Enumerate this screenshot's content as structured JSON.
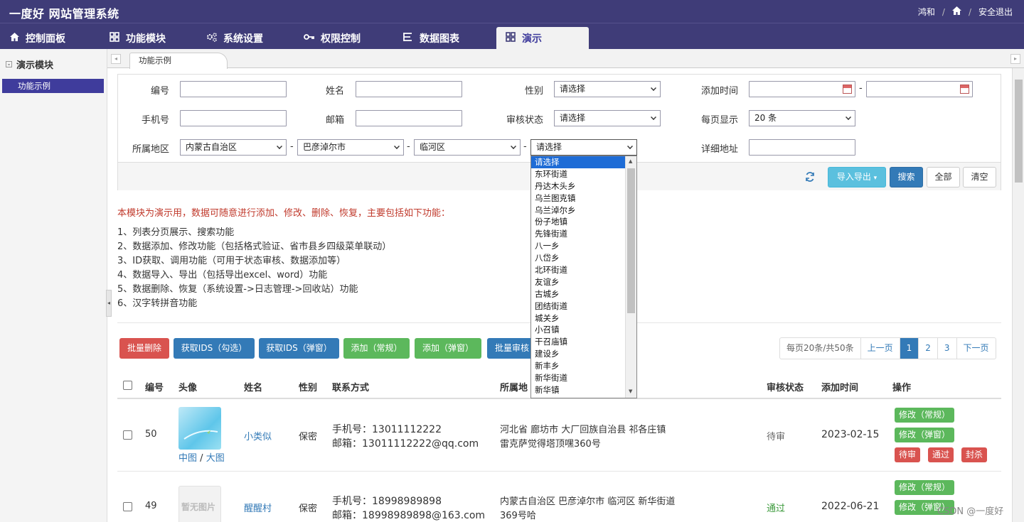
{
  "header": {
    "app_title": "一度好 网站管理系统",
    "user": "鸿和",
    "separator": "/",
    "home_icon": "home-icon",
    "logout": "安全退出"
  },
  "nav": {
    "tabs": [
      {
        "label": "控制面板",
        "icon": "home-icon"
      },
      {
        "label": "功能模块",
        "icon": "grid-icon"
      },
      {
        "label": "系统设置",
        "icon": "cogs-icon"
      },
      {
        "label": "权限控制",
        "icon": "key-icon"
      },
      {
        "label": "数据图表",
        "icon": "list-icon"
      },
      {
        "label": "演示",
        "icon": "grid-icon",
        "active": true
      }
    ]
  },
  "sidebar": {
    "section": "演示模块",
    "items": [
      {
        "label": "功能示例",
        "active": true
      }
    ]
  },
  "page_tab": "功能示例",
  "filters": {
    "id_label": "编号",
    "name_label": "姓名",
    "gender_label": "性别",
    "gender_value": "请选择",
    "added_time_label": "添加时间",
    "date_dash": "-",
    "phone_label": "手机号",
    "email_label": "邮箱",
    "audit_label": "审核状态",
    "audit_value": "请选择",
    "per_page_label": "每页显示",
    "per_page_value": "20 条",
    "region_label": "所属地区",
    "province": "内蒙古自治区",
    "city": "巴彦淖尔市",
    "district": "临河区",
    "town": "请选择",
    "address_label": "详细地址",
    "refresh_icon": "refresh-icon",
    "import_export": "导入导出",
    "search": "搜索",
    "all": "全部",
    "clear": "清空"
  },
  "town_options": [
    "请选择",
    "东环街道",
    "丹达木头乡",
    "乌兰图克镇",
    "乌兰淖尔乡",
    "份子地镇",
    "先锋街道",
    "八一乡",
    "八岱乡",
    "北环街道",
    "友谊乡",
    "古城乡",
    "团结街道",
    "城关乡",
    "小召镇",
    "干召庙镇",
    "建设乡",
    "新丰乡",
    "新华街道",
    "新华镇"
  ],
  "info": {
    "intro": "本模块为演示用，数据可随意进行添加、修改、删除、恢复，主要包括如下功能：",
    "lines": [
      "1、列表分页展示、搜索功能",
      "2、数据添加、修改功能（包括格式验证、省市县乡四级菜单联动）",
      "3、ID获取、调用功能（可用于状态审核、数据添加等）",
      "4、数据导入、导出（包括导出excel、word）功能",
      "5、数据删除、恢复（系统设置->日志管理->回收站）功能",
      "6、汉字转拼音功能"
    ]
  },
  "actions": {
    "batch_delete": "批量删除",
    "get_ids_check": "获取IDS（勾选）",
    "get_ids_popup": "获取IDS（弹窗）",
    "add_normal": "添加（常规）",
    "add_popup": "添加（弹窗）",
    "batch_audit": "批量审核"
  },
  "pager": {
    "info": "每页20条/共50条",
    "prev": "上一页",
    "pages": [
      "1",
      "2",
      "3"
    ],
    "current": "1",
    "next": "下一页"
  },
  "table": {
    "headers": {
      "id": "编号",
      "avatar": "头像",
      "name": "姓名",
      "gender": "性别",
      "contact": "联系方式",
      "region": "所属地",
      "audit": "审核状态",
      "time": "添加时间",
      "ops": "操作"
    },
    "rows": [
      {
        "id": "50",
        "avatar_links": {
          "mid": "中图",
          "sep": "/",
          "big": "大图"
        },
        "name": "小类似",
        "gender": "保密",
        "phone": "手机号：13011112222",
        "email": "邮箱：13011112222@qq.com",
        "region_line1": "河北省 廊坊市 大厂回族自治县 祁各庄镇",
        "region_line2": "雷克萨觉得塔顶嘿360号",
        "audit": "待审",
        "time": "2023-02-15",
        "ops": [
          "修改（常规）",
          "修改（弹窗）",
          "待审",
          "通过",
          "封杀"
        ]
      },
      {
        "id": "49",
        "avatar_text": "暂无图片",
        "name": "醒醒村",
        "gender": "保密",
        "phone": "手机号：18998989898",
        "email": "邮箱：18998989898@163.com",
        "region_line1": "内蒙古自治区 巴彦淖尔市 临河区 新华街道",
        "region_line2": "369号哈",
        "audit": "通过",
        "time": "2022-06-21",
        "ops": [
          "修改（常规）",
          "修改（弹窗）"
        ]
      }
    ]
  },
  "watermark": "CSDN @一度好",
  "colors": {
    "header_bg": "#3f3c78",
    "primary": "#337ab7",
    "success": "#5cb85c",
    "danger": "#d9534f",
    "info": "#5bc0de"
  }
}
